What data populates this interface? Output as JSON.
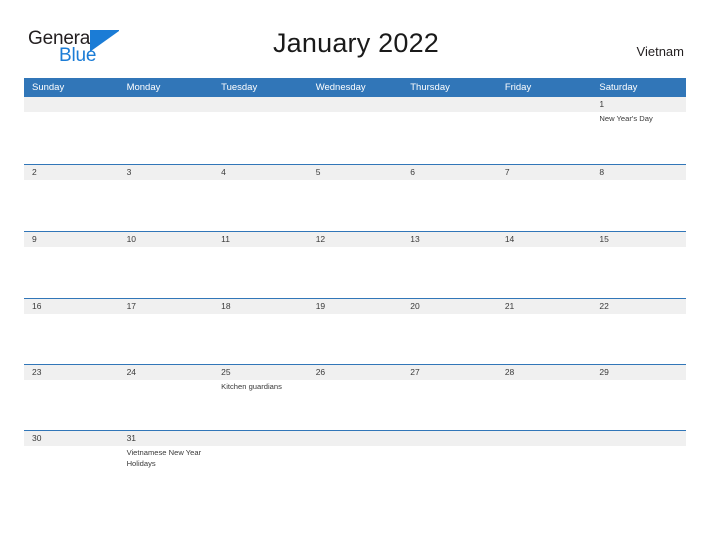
{
  "brand": {
    "name_part1": "General",
    "name_part2": "Blue",
    "flag_icon": "flag-triangle-icon",
    "colors": {
      "part1": "#231f20",
      "part2": "#1b7cd6",
      "flag": "#1b7cd6"
    }
  },
  "header": {
    "title": "January 2022",
    "country": "Vietnam"
  },
  "colors": {
    "header_blue": "#3176b8",
    "row_separator_blue": "#3176b8",
    "day_band_gray": "#f0f0f0",
    "text": "#3a3a3a",
    "page_background": "#ffffff"
  },
  "calendar": {
    "weekdays": [
      "Sunday",
      "Monday",
      "Tuesday",
      "Wednesday",
      "Thursday",
      "Friday",
      "Saturday"
    ],
    "weeks": [
      {
        "days": [
          {
            "number": "",
            "events": []
          },
          {
            "number": "",
            "events": []
          },
          {
            "number": "",
            "events": []
          },
          {
            "number": "",
            "events": []
          },
          {
            "number": "",
            "events": []
          },
          {
            "number": "",
            "events": []
          },
          {
            "number": "1",
            "events": [
              "New Year's Day"
            ]
          }
        ]
      },
      {
        "days": [
          {
            "number": "2",
            "events": []
          },
          {
            "number": "3",
            "events": []
          },
          {
            "number": "4",
            "events": []
          },
          {
            "number": "5",
            "events": []
          },
          {
            "number": "6",
            "events": []
          },
          {
            "number": "7",
            "events": []
          },
          {
            "number": "8",
            "events": []
          }
        ]
      },
      {
        "days": [
          {
            "number": "9",
            "events": []
          },
          {
            "number": "10",
            "events": []
          },
          {
            "number": "11",
            "events": []
          },
          {
            "number": "12",
            "events": []
          },
          {
            "number": "13",
            "events": []
          },
          {
            "number": "14",
            "events": []
          },
          {
            "number": "15",
            "events": []
          }
        ]
      },
      {
        "days": [
          {
            "number": "16",
            "events": []
          },
          {
            "number": "17",
            "events": []
          },
          {
            "number": "18",
            "events": []
          },
          {
            "number": "19",
            "events": []
          },
          {
            "number": "20",
            "events": []
          },
          {
            "number": "21",
            "events": []
          },
          {
            "number": "22",
            "events": []
          }
        ]
      },
      {
        "days": [
          {
            "number": "23",
            "events": []
          },
          {
            "number": "24",
            "events": []
          },
          {
            "number": "25",
            "events": [
              "Kitchen guardians"
            ]
          },
          {
            "number": "26",
            "events": []
          },
          {
            "number": "27",
            "events": []
          },
          {
            "number": "28",
            "events": []
          },
          {
            "number": "29",
            "events": []
          }
        ]
      },
      {
        "days": [
          {
            "number": "30",
            "events": []
          },
          {
            "number": "31",
            "events": [
              "Vietnamese New Year Holidays"
            ]
          },
          {
            "number": "",
            "events": []
          },
          {
            "number": "",
            "events": []
          },
          {
            "number": "",
            "events": []
          },
          {
            "number": "",
            "events": []
          },
          {
            "number": "",
            "events": []
          }
        ]
      }
    ]
  }
}
